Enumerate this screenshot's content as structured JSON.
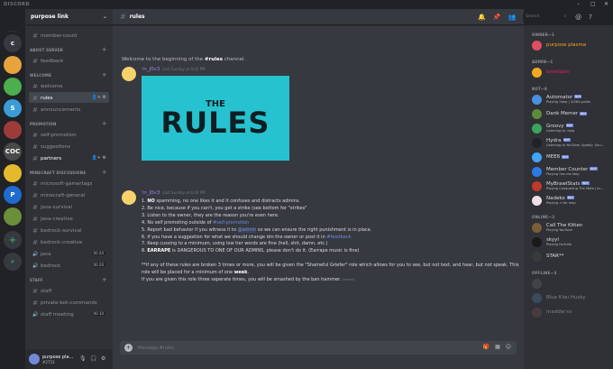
{
  "app": {
    "title": "DISCORD"
  },
  "servers": [
    {
      "label": "c",
      "color": "#36393f"
    },
    {
      "label": "",
      "color": "#e8a33d"
    },
    {
      "label": "",
      "color": "#4cae4f"
    },
    {
      "label": "S",
      "color": "#3b9bd6"
    },
    {
      "label": "",
      "color": "#9d3b3b"
    },
    {
      "label": "COC",
      "color": "#4a4a4a"
    },
    {
      "label": "",
      "color": "#e4b92c"
    },
    {
      "label": "P",
      "color": "#1f6bd0"
    },
    {
      "label": "",
      "color": "#6b8e3a"
    }
  ],
  "server": {
    "name": "purpose link"
  },
  "sidebar": {
    "top": [
      {
        "label": "member-count"
      }
    ],
    "categories": [
      {
        "name": "ABOUT SERVER",
        "channels": [
          {
            "label": "feedback",
            "type": "text"
          }
        ]
      },
      {
        "name": "WELCOME",
        "channels": [
          {
            "label": "welcome",
            "type": "text"
          },
          {
            "label": "rules",
            "type": "text",
            "active": true
          },
          {
            "label": "announcements",
            "type": "text"
          }
        ]
      },
      {
        "name": "PROMOTION",
        "channels": [
          {
            "label": "self-promotion",
            "type": "text"
          },
          {
            "label": "suggestions",
            "type": "text"
          },
          {
            "label": "partners",
            "type": "text",
            "unread": true
          }
        ]
      },
      {
        "name": "MINECRAFT DISCUSSIONS",
        "channels": [
          {
            "label": "microsoft-gamertags",
            "type": "text"
          },
          {
            "label": "minecraft-general",
            "type": "text"
          },
          {
            "label": "java-survival",
            "type": "text"
          },
          {
            "label": "java-creative",
            "type": "text"
          },
          {
            "label": "bedrock-survival",
            "type": "text"
          },
          {
            "label": "bedrock-creative",
            "type": "text"
          },
          {
            "label": "java",
            "type": "voice",
            "count": "00 20"
          },
          {
            "label": "bedrock",
            "type": "voice",
            "count": "00 20"
          }
        ]
      },
      {
        "name": "STAFF",
        "channels": [
          {
            "label": "staff",
            "type": "text"
          },
          {
            "label": "private-bot-commands",
            "type": "text"
          },
          {
            "label": "staff meeting",
            "type": "voice",
            "count": "00 10"
          }
        ]
      }
    ]
  },
  "user": {
    "name": "purpose pla...",
    "tag": "#2753"
  },
  "channel": {
    "name": "rules"
  },
  "search": {
    "placeholder": "Search"
  },
  "welcome": {
    "prefix": "Welcome to the beginning of the ",
    "channel": "#rules",
    "suffix": " channel."
  },
  "messages": [
    {
      "author": "!n_J0v3",
      "timestamp": "Last Sunday at 6:02 PM",
      "image": {
        "the": "THE",
        "rules": "RULES"
      }
    },
    {
      "author": "!n_J0v3",
      "timestamp": "Last Sunday at 6:04 PM",
      "rules": [
        {
          "pre": "1. ",
          "bold": "NO",
          "post": " spamming, no one likes it and it confuses and distracts admins."
        },
        {
          "pre": "2. Be nice, because if you can't, you get a strike (see bottom for \"strikes\"",
          "bold": "",
          "post": ""
        },
        {
          "pre": "3. Listen to the owner, they are the reason you're even here.",
          "bold": "",
          "post": ""
        },
        {
          "pre": "4. No self promoting outside of ",
          "link": "#self-promotion",
          "post": ""
        },
        {
          "pre": "5. Report bad behavior if you witness it to ",
          "mention": "@admin",
          "post": " so we can ensure the right punishment is in place."
        },
        {
          "pre": "6. If you have a suggestion for what we should change dm the owner or post it in ",
          "link": "#feedback",
          "post": ""
        },
        {
          "pre": "7. Keep cussing to a minimum, using low tier words are fine (hell, shit, damn, etc.)",
          "bold": "",
          "post": ""
        },
        {
          "pre": "8. ",
          "bold": "EARRAPE",
          "post": " is DANGEROUS TO ONE OF OUR ADMINS, please don't do it. (Earrape music is fine)"
        }
      ],
      "para1": "**if any of these rules are broken 3 times or more, you will be given the \"Shameful Griefer\" role which allows for you to see, but not text, and hear, but not speak. This",
      "para2_pre": "role will be placed for a minimum of one ",
      "para2_bold": "week",
      "para2_post": ".",
      "para3": "If you are given this role three seperate times, you will be smashed by the ban hammer.",
      "edited": "(edited)"
    }
  ],
  "composer": {
    "placeholder": "Message #rules"
  },
  "members": {
    "groups": [
      {
        "name": "OWNER—1",
        "items": [
          {
            "name": "purpose plasma",
            "color": "#faa61a",
            "avatar": "#e04f5f"
          }
        ]
      },
      {
        "name": "ADMIN—1",
        "items": [
          {
            "name": "bmetizen",
            "color": "#e91e63",
            "avatar": "#f5a623"
          }
        ]
      },
      {
        "name": "BOT—8",
        "items": [
          {
            "name": "Automator",
            "bot": "BOT",
            "sub": "Playing !help | 3/364 guilds",
            "avatar": "#4a90e2"
          },
          {
            "name": "Dank Memer",
            "bot": "BOT",
            "sub": "",
            "avatar": "#5b8c3a"
          },
          {
            "name": "Groovy",
            "bot": "BOT",
            "sub": "Listening to -help",
            "avatar": "#3ba55c"
          },
          {
            "name": "Hydra",
            "bot": "BOT",
            "sub": "Listening to YouTube, Spotify, Sou...",
            "avatar": "#202225"
          },
          {
            "name": "MEE6",
            "bot": "BOT",
            "sub": "",
            "avatar": "#42a5f5"
          },
          {
            "name": "Member Counter",
            "bot": "BOT",
            "sub": "Playing !mc.ms help",
            "avatar": "#2c7be5"
          },
          {
            "name": "MyBrawlStats",
            "bot": "BOT",
            "sub": "Playing Conquering The Meta | br...",
            "avatar": "#c0392b"
          },
          {
            "name": "Nadeko",
            "bot": "BOT",
            "sub": "Playing .h for help",
            "avatar": "#f0e0e6"
          }
        ]
      },
      {
        "name": "ONLINE—3",
        "items": [
          {
            "name": "Call The Kitten",
            "sub": "Playing YouTube",
            "avatar": "#7b5e3a"
          },
          {
            "name": "skyyl",
            "sub": "Playing Fortnite",
            "avatar": "#1a1a1a"
          },
          {
            "name": "STAR**",
            "sub": "",
            "avatar": "#3a3a3a"
          }
        ]
      },
      {
        "name": "OFFLINE—3",
        "offline": true,
        "items": [
          {
            "name": "",
            "sub": "",
            "avatar": "#5a5a5a"
          },
          {
            "name": "Blue Kiwi Husky",
            "sub": "",
            "avatar": "#4a6a8a"
          },
          {
            "name": "maddie'xs",
            "sub": "",
            "avatar": "#6a4a4a"
          }
        ]
      }
    ]
  }
}
